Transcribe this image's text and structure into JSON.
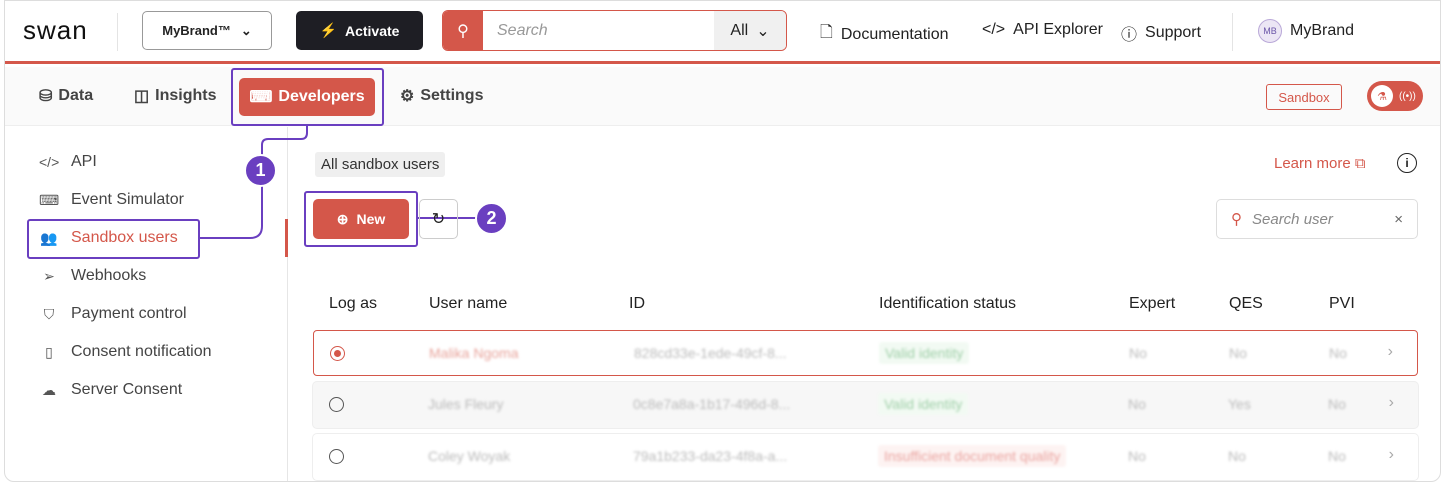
{
  "header": {
    "logo": "swan",
    "brand": "MyBrand™",
    "activate": "Activate",
    "search_placeholder": "Search",
    "search_scope": "All",
    "links": [
      "Documentation",
      "API Explorer",
      "Support"
    ],
    "user_initials": "MB",
    "user_name": "MyBrand"
  },
  "nav": {
    "tabs": [
      "Data",
      "Insights",
      "Developers",
      "Settings"
    ],
    "environment": "Sandbox"
  },
  "sidebar": {
    "items": [
      "API",
      "Event Simulator",
      "Sandbox users",
      "Webhooks",
      "Payment control",
      "Consent notification",
      "Server Consent"
    ]
  },
  "main": {
    "chip": "All sandbox users",
    "learn_more": "Learn more",
    "new_button": "New",
    "search_placeholder": "Search user",
    "annotations": [
      "1",
      "2"
    ],
    "columns": [
      "Log as",
      "User name",
      "ID",
      "Identification status",
      "Expert",
      "QES",
      "PVI"
    ],
    "rows": [
      {
        "name": "Malika Ngoma",
        "id": "828cd33e-1ede-49cf-8...",
        "status": "Valid identity",
        "expert": "No",
        "qes": "No",
        "pvi": "No",
        "selected": true
      },
      {
        "name": "Jules Fleury",
        "id": "0c8e7a8a-1b17-496d-8...",
        "status": "Valid identity",
        "expert": "No",
        "qes": "Yes",
        "pvi": "No",
        "selected": false
      },
      {
        "name": "Coley Woyak",
        "id": "79a1b233-da23-4f8a-a...",
        "status": "Insufficient document quality",
        "expert": "No",
        "qes": "No",
        "pvi": "No",
        "selected": false
      }
    ]
  },
  "colors": {
    "accent": "#d4574a",
    "annotation": "#6a3fc0"
  }
}
